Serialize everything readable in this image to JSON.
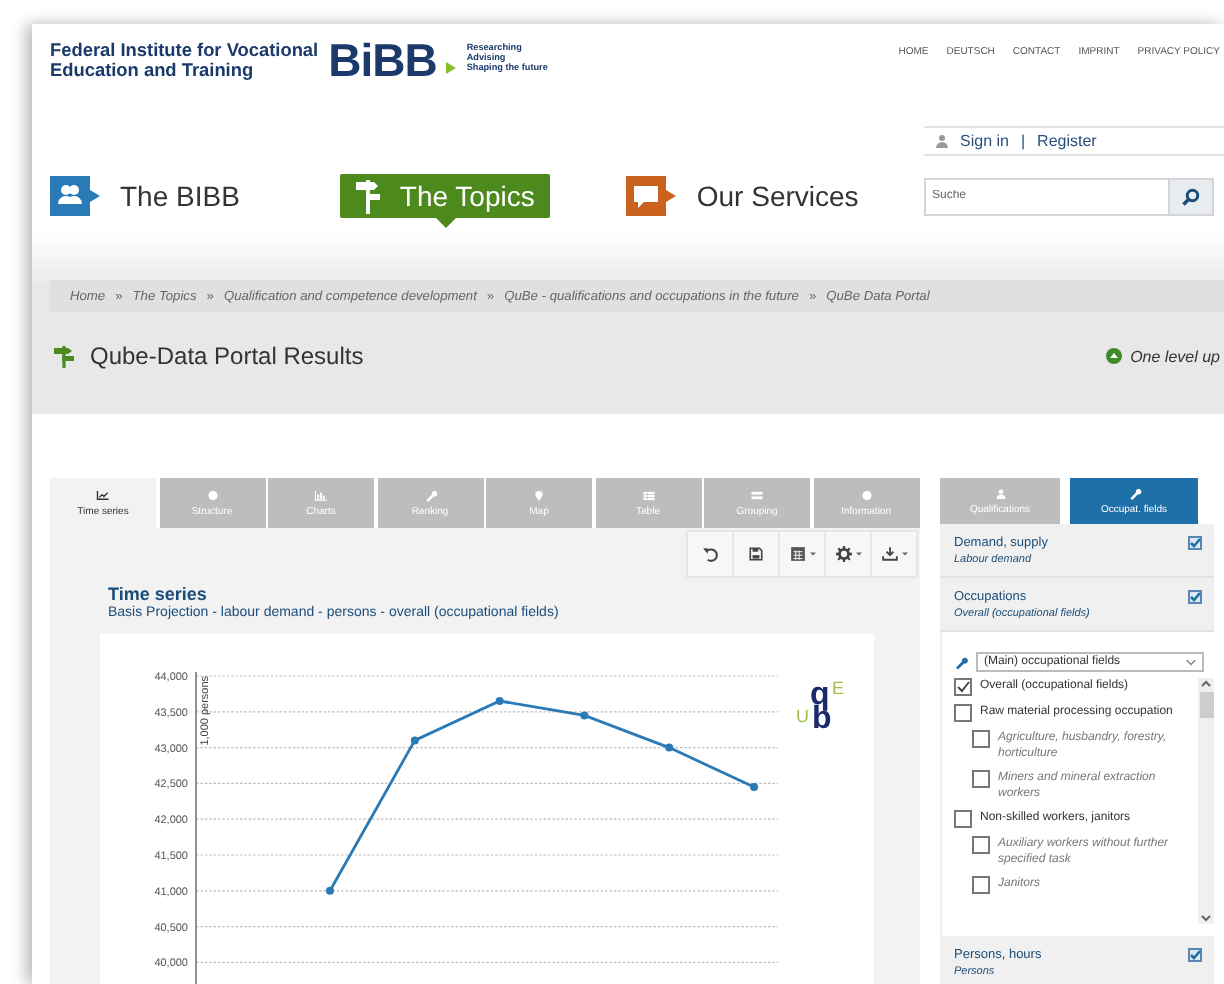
{
  "header": {
    "org_name": [
      "Federal Institute for Vocational",
      "Education and Training"
    ],
    "logo": "BiBB",
    "tagline": [
      "Researching",
      "Advising",
      "Shaping the future"
    ],
    "top_links": [
      "HOME",
      "DEUTSCH",
      "CONTACT",
      "IMPRINT",
      "PRIVACY POLICY"
    ],
    "account": {
      "sign_in": "Sign in",
      "separator": "|",
      "register": "Register"
    },
    "search": {
      "placeholder": "Suche"
    }
  },
  "nav": [
    {
      "label": "The BIBB",
      "selected": false,
      "kind": "people",
      "color": "#2a7ab8"
    },
    {
      "label": "The Topics",
      "selected": true,
      "kind": "signpost",
      "color": "#4d8a1e"
    },
    {
      "label": "Our Services",
      "selected": false,
      "kind": "speech",
      "color": "#c8621c"
    }
  ],
  "breadcrumb": [
    {
      "label": "Home"
    },
    {
      "separator": "»",
      "label": "The Topics"
    },
    {
      "separator": "»",
      "label": "Qualification and competence development"
    },
    {
      "separator": "»",
      "label": "QuBe - qualifications and occupations in the future"
    },
    {
      "separator": "»",
      "label": "QuBe Data Portal"
    }
  ],
  "page_title": "Qube-Data Portal Results",
  "level_up": "One level up",
  "main": {
    "tabs": [
      {
        "label": "Time series",
        "selected": true
      },
      {
        "label": "Structure",
        "selected": false
      },
      {
        "label": "Charts",
        "selected": false
      },
      {
        "label": "Ranking",
        "selected": false
      },
      {
        "label": "Map",
        "selected": false
      },
      {
        "label": "Table",
        "selected": false
      },
      {
        "label": "Grouping",
        "selected": false
      },
      {
        "label": "Information",
        "selected": false
      }
    ],
    "toolbar": [
      {
        "dropdown": false
      },
      {
        "dropdown": false
      },
      {
        "dropdown": true
      },
      {
        "dropdown": true
      },
      {
        "dropdown": true
      }
    ],
    "heading": "Time series",
    "subtitle": "Basis Projection - labour demand - persons - overall (occupational fields)",
    "logo_letters": [
      "q",
      "E",
      "U",
      "b"
    ],
    "chart_data": {
      "type": "line",
      "grid": true,
      "ylabel": "1,000 persons",
      "ylim": [
        39700,
        44000
      ],
      "yticks": [
        {
          "value": 40000,
          "label": "40,000"
        },
        {
          "value": 40500,
          "label": "40,500"
        },
        {
          "value": 41000,
          "label": "41,000"
        },
        {
          "value": 41500,
          "label": "41,500"
        },
        {
          "value": 42000,
          "label": "42,000"
        },
        {
          "value": 42500,
          "label": "42,500"
        },
        {
          "value": 43000,
          "label": "43,000"
        },
        {
          "value": 43500,
          "label": "43,500"
        },
        {
          "value": 44000,
          "label": "44,000"
        }
      ],
      "series": [
        {
          "color": "#2a7ab8",
          "marker": true,
          "values": [
            null,
            41000,
            43100,
            43650,
            43450,
            43000,
            42450
          ]
        }
      ]
    }
  },
  "sidebar": {
    "tabs": [
      {
        "label": "Qualifications",
        "selected": false
      },
      {
        "label": "Occupat. fields",
        "selected": true
      }
    ],
    "sections": [
      {
        "title": "Demand, supply",
        "value": "Labour demand",
        "checked": true
      },
      {
        "title": "Occupations",
        "value": "Overall (occupational fields)",
        "checked": true
      }
    ],
    "dropdown": {
      "value": "(Main) occupational fields"
    },
    "tree": [
      {
        "label": "Overall (occupational fields)",
        "checked": true
      },
      {
        "label": "Raw material processing occupation",
        "checked": false,
        "children": [
          {
            "label": "Agriculture, husbandry, forestry, horticulture",
            "checked": false
          },
          {
            "label": "Miners and mineral extraction workers",
            "checked": false
          }
        ]
      },
      {
        "label": "Non-skilled workers, janitors",
        "checked": false,
        "children": [
          {
            "label": "Auxiliary workers without further specified task",
            "checked": false
          },
          {
            "label": "Janitors",
            "checked": false
          }
        ]
      }
    ],
    "footer_sections": [
      {
        "title": "Persons, hours",
        "value": "Persons",
        "checked": true
      }
    ]
  }
}
